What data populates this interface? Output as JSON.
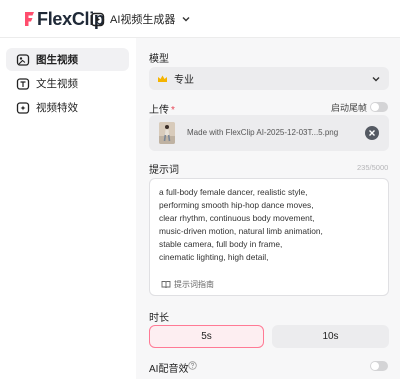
{
  "header": {
    "logo_text": "FlexClip",
    "tool_selector": {
      "label": "AI视频生成器"
    }
  },
  "sidebar": {
    "items": [
      {
        "label": "图生视频",
        "active": true
      },
      {
        "label": "文生视频",
        "active": false
      },
      {
        "label": "视频特效",
        "active": false
      }
    ]
  },
  "form": {
    "model": {
      "label": "模型",
      "value": "专业"
    },
    "upload": {
      "label": "上传",
      "required_mark": "*",
      "tail_frame_label": "启动尾帧",
      "tail_frame_on": false,
      "file_name": "Made with FlexClip AI-2025-12-03T...5.png"
    },
    "prompt": {
      "label": "提示词",
      "char_count": "235/5000",
      "lines": [
        "a full-body female dancer, realistic style,",
        "performing smooth hip-hop dance moves,",
        "clear rhythm, continuous body movement,",
        "music-driven motion, natural limb animation,",
        "stable camera, full body in frame,",
        "cinematic lighting, high detail,"
      ],
      "guide_label": "提示词指南"
    },
    "duration": {
      "label": "时长",
      "options": [
        "5s",
        "10s"
      ],
      "selected": "5s"
    },
    "ai_audio": {
      "label": "AI配音效",
      "on": false
    }
  },
  "colors": {
    "accent": "#ff5a7d",
    "selected_border": "#ff7a95",
    "selected_bg": "#fdeef1",
    "panel_bg": "#f7f7f8",
    "control_bg": "#ececee"
  }
}
